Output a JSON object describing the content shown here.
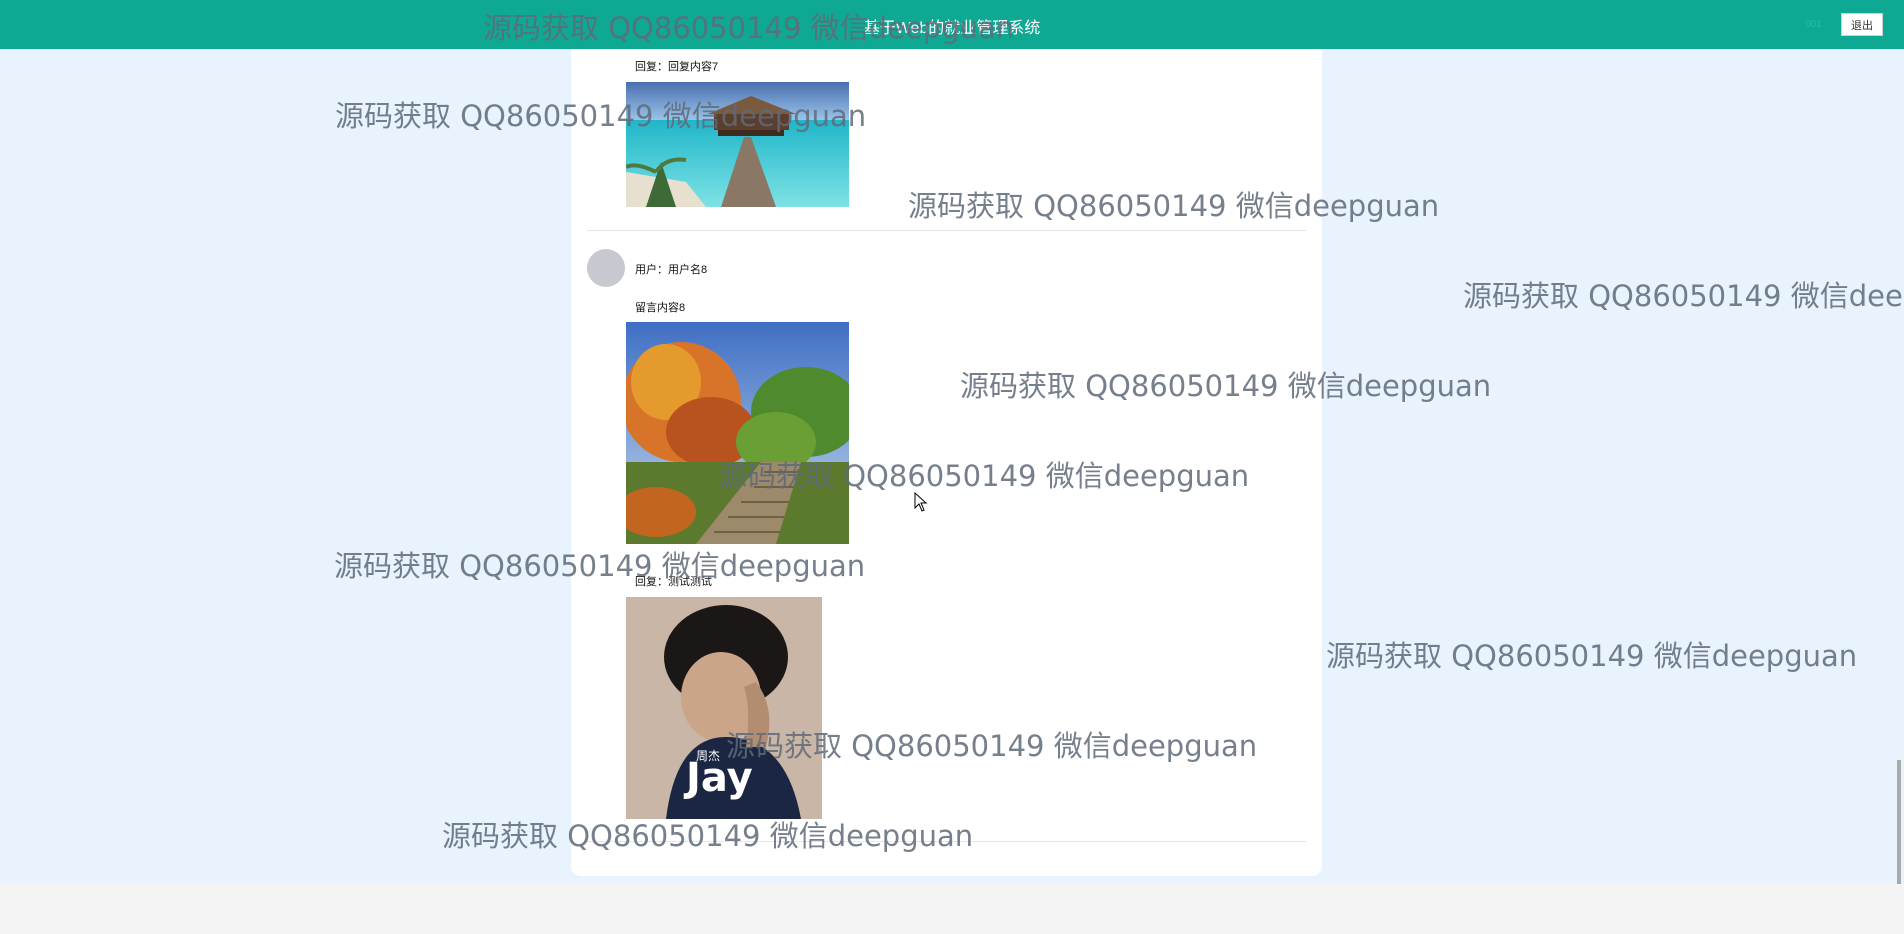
{
  "header": {
    "title": "基于Web的就业管理系统",
    "username": "001",
    "logout_label": "退出"
  },
  "messages": [
    {
      "reply_label": "回复：回复内容7",
      "reply_image": "beach-pier-photo"
    },
    {
      "username_label": "用户：用户名8",
      "content_label": "留言内容8",
      "content_image": "autumn-stairs-photo",
      "reply_label": "回复：测试测试",
      "reply_image": "jay-album-cover"
    }
  ],
  "album_text": "Jay",
  "album_chinese": "周杰",
  "watermark": "源码获取 QQ86050149 微信deepguan",
  "colors": {
    "header": "#0fa893",
    "page_background": "#e8f3fe",
    "card": "#ffffff"
  }
}
